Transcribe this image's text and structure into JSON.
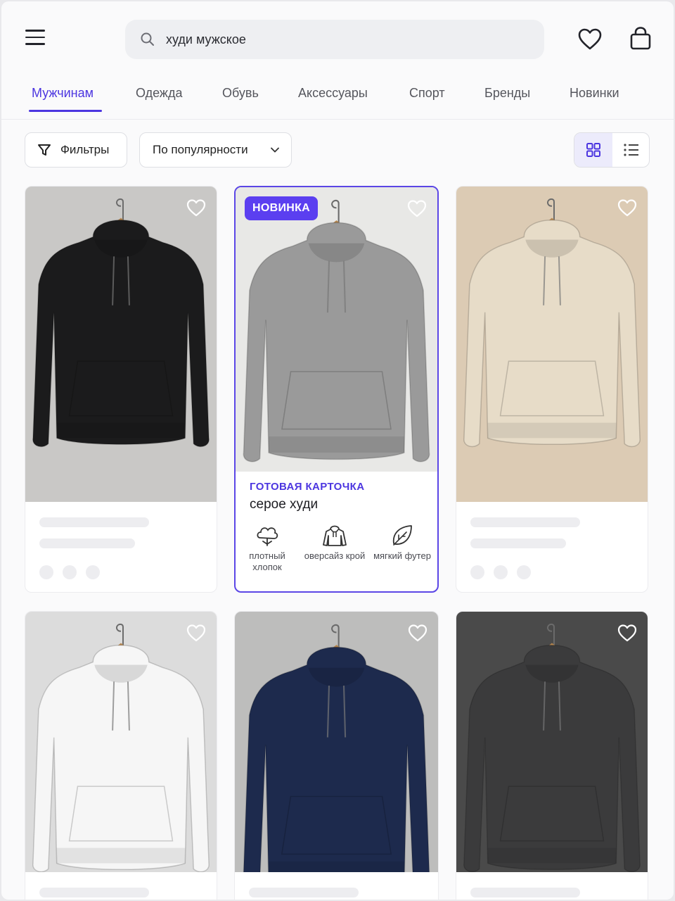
{
  "search": {
    "query": "худи мужское"
  },
  "icons": {
    "menu": "menu-icon",
    "search": "search-icon",
    "favorites": "heart-icon",
    "cart": "shopping-bag-icon",
    "filter": "filter-icon",
    "grid": "grid-icon",
    "list": "list-icon"
  },
  "tabs": [
    {
      "label": "Мужчинам",
      "active": true
    },
    {
      "label": "Одежда"
    },
    {
      "label": "Обувь"
    },
    {
      "label": "Аксессуары"
    },
    {
      "label": "Спорт"
    },
    {
      "label": "Бренды"
    },
    {
      "label": "Новинки"
    }
  ],
  "toolbar": {
    "filters_label": "Фильтры",
    "sort_label": "По популярности",
    "view_mode": "grid"
  },
  "colors": {
    "accent": "#5b3ff0"
  },
  "products": [
    {
      "color_name": "black",
      "hoodie_color": "#1b1b1c",
      "background": "#c9c8c6",
      "highlighted": false
    },
    {
      "color_name": "grey",
      "hoodie_color": "#9a9a9a",
      "background": "#e8e8e6",
      "highlighted": true,
      "badge": "НОВИНКА",
      "kicker": "ГОТОВАЯ КАРТОЧКА",
      "title": "серое худи",
      "features": [
        {
          "icon": "cotton-icon",
          "label": "плотный хлопок"
        },
        {
          "icon": "hoodie-icon",
          "label": "оверсайз крой"
        },
        {
          "icon": "leaf-icon",
          "label": "мягкий футер"
        }
      ]
    },
    {
      "color_name": "beige",
      "hoodie_color": "#e7dcc8",
      "background": "#dccbb4",
      "highlighted": false
    },
    {
      "color_name": "white",
      "hoodie_color": "#f6f6f6",
      "background": "#dcdcdc",
      "highlighted": false
    },
    {
      "color_name": "navy",
      "hoodie_color": "#1d2a4d",
      "background": "#bdbdbc",
      "highlighted": false
    },
    {
      "color_name": "charcoal",
      "hoodie_color": "#3b3b3c",
      "background": "#4a4a4a",
      "highlighted": false
    }
  ]
}
